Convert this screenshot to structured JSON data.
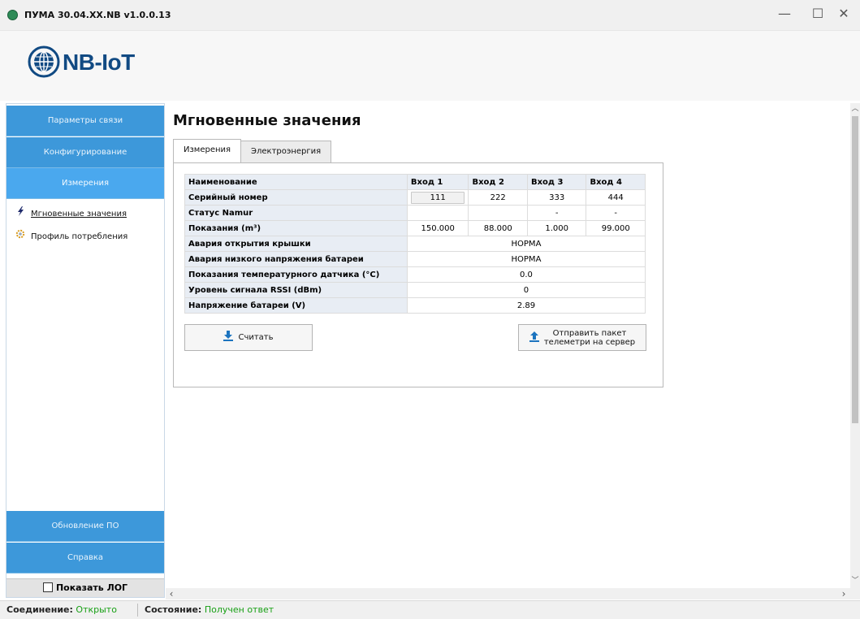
{
  "window": {
    "title": "ПУМА 30.04.XX.NB v1.0.0.13",
    "minimize": "—",
    "maximize": "☐",
    "close": "✕"
  },
  "logo": {
    "text": "NB-IoT",
    "color": "#114a83"
  },
  "sidebar": {
    "nav_top": [
      {
        "label": "Параметры связи"
      },
      {
        "label": "Конфигурирование"
      },
      {
        "label": "Измерения",
        "active": true
      }
    ],
    "sub_items": [
      {
        "label": "Мгновенные значения",
        "icon": "lightning-icon"
      },
      {
        "label": "Профиль потребления",
        "icon": "gear-icon"
      }
    ],
    "nav_bottom": [
      {
        "label": "Обновление ПО"
      },
      {
        "label": "Справка"
      }
    ],
    "show_log": {
      "label": "Показать ЛОГ",
      "checked": false
    }
  },
  "main": {
    "title": "Мгновенные значения",
    "tabs": [
      {
        "label": "Измерения",
        "active": true
      },
      {
        "label": "Электроэнергия"
      }
    ],
    "table": {
      "headers": [
        "Наименование",
        "Вход 1",
        "Вход 2",
        "Вход 3",
        "Вход 4"
      ],
      "serial": {
        "label": "Серийный номер",
        "values": [
          "111",
          "222",
          "333",
          "444"
        ]
      },
      "namur": {
        "label": "Статус Namur",
        "values": [
          "",
          "",
          "-",
          "-"
        ]
      },
      "readings": {
        "label": "Показания (m³)",
        "values": [
          "150.000",
          "88.000",
          "1.000",
          "99.000"
        ]
      },
      "spanned": [
        {
          "label": "Авария открытия крышки",
          "value": "НОРМА"
        },
        {
          "label": "Авария низкого напряжения батареи",
          "value": "НОРМА"
        },
        {
          "label": "Показания температурного датчика (°C)",
          "value": "0.0"
        },
        {
          "label": "Уровень сигнала RSSI (dBm)",
          "value": "0"
        },
        {
          "label": "Напряжение батареи (V)",
          "value": "2.89"
        }
      ]
    },
    "read_button": "Считать",
    "send_button_line1": "Отправить пакет",
    "send_button_line2": "телеметри на сервер"
  },
  "status": {
    "connection_label": "Соединение:",
    "connection_value": "Открыто",
    "state_label": "Состояние:",
    "state_value": "Получен ответ",
    "value_color": "#18a015"
  }
}
